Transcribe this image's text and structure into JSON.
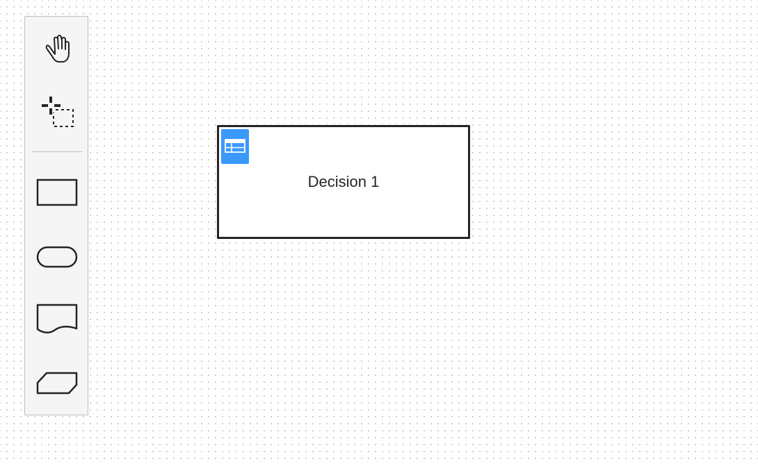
{
  "palette": {
    "tools": [
      {
        "icon": "hand-icon"
      },
      {
        "icon": "lasso-icon"
      }
    ],
    "shapes": [
      {
        "icon": "rectangle-icon"
      },
      {
        "icon": "rounded-rectangle-icon"
      },
      {
        "icon": "document-icon"
      },
      {
        "icon": "parallelogram-icon"
      }
    ]
  },
  "canvas": {
    "element": {
      "label": "Decision 1",
      "badge_icon": "table-icon",
      "badge_color": "#3b99fc",
      "border_color": "#22242a"
    }
  }
}
